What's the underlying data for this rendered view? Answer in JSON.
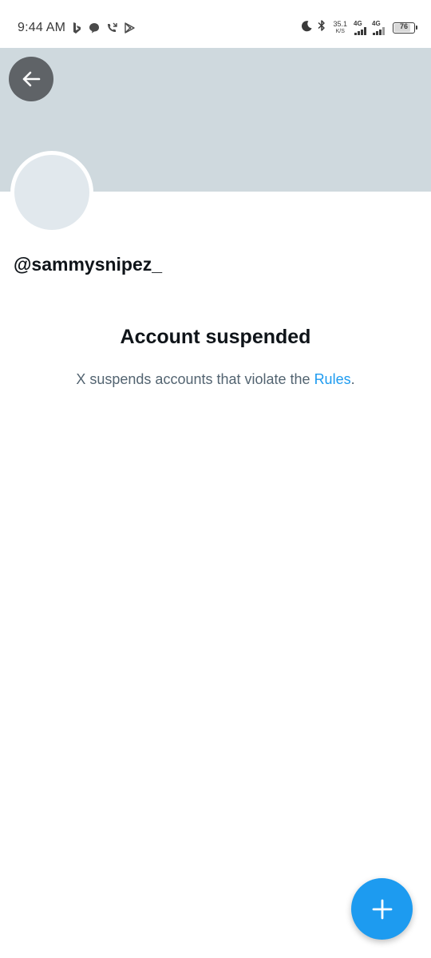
{
  "status_bar": {
    "time": "9:44 AM",
    "left_icons": [
      "bing-icon",
      "message-bubble-icon",
      "missed-call-icon",
      "play-store-icon"
    ],
    "right_icons": [
      "moon-icon",
      "bluetooth-icon"
    ],
    "net_speed_value": "35.1",
    "net_speed_unit": "K/S",
    "sim1_label": "4G",
    "sim2_label": "4G",
    "battery_level": "76"
  },
  "header": {
    "back_icon": "arrow-left-icon",
    "banner_color": "#cfd9de"
  },
  "profile": {
    "handle": "@sammysnipez_"
  },
  "suspension": {
    "title": "Account suspended",
    "message_prefix": "X suspends accounts that violate the ",
    "rules_link": "Rules",
    "message_suffix": "."
  },
  "fab": {
    "icon": "plus-icon",
    "color": "#1d9bf0"
  },
  "colors": {
    "accent": "#1d9bf0",
    "text_primary": "#0f1419",
    "text_secondary": "#536471"
  }
}
